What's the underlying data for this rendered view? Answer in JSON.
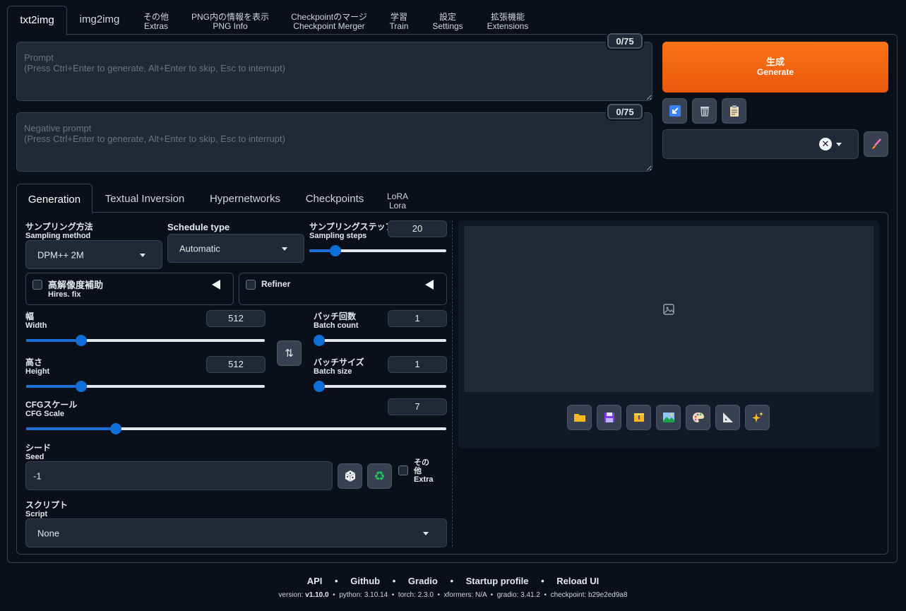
{
  "top_tabs": {
    "txt2img": "txt2img",
    "img2img": "img2img",
    "extras_jp": "その他",
    "extras_en": "Extras",
    "pnginfo_jp": "PNG内の情報を表示",
    "pnginfo_en": "PNG Info",
    "merger_jp": "Checkpointのマージ",
    "merger_en": "Checkpoint Merger",
    "train_jp": "学習",
    "train_en": "Train",
    "settings_jp": "設定",
    "settings_en": "Settings",
    "extensions_jp": "拡張機能",
    "extensions_en": "Extensions"
  },
  "prompt": {
    "placeholder": "Prompt\n(Press Ctrl+Enter to generate, Alt+Enter to skip, Esc to interrupt)",
    "counter": "0/75"
  },
  "negative_prompt": {
    "placeholder": "Negative prompt\n(Press Ctrl+Enter to generate, Alt+Enter to skip, Esc to interrupt)",
    "counter": "0/75"
  },
  "generate": {
    "jp": "生成",
    "en": "Generate"
  },
  "tool_icons": [
    "arrow-icon",
    "trash-icon",
    "clipboard-icon",
    "brush-icon",
    "close-icon"
  ],
  "sub_tabs": {
    "generation": "Generation",
    "textual_inversion": "Textual Inversion",
    "hypernetworks": "Hypernetworks",
    "checkpoints": "Checkpoints",
    "lora_jp": "LoRA",
    "lora_en": "Lora"
  },
  "sampling_method": {
    "jp": "サンプリング方法",
    "en": "Sampling method",
    "value": "DPM++ 2M"
  },
  "schedule_type": {
    "label": "Schedule type",
    "value": "Automatic"
  },
  "sampling_steps": {
    "jp": "サンプリングステップ数",
    "en": "Sampling steps",
    "value": "20",
    "fraction": 0.19
  },
  "hires": {
    "jp": "高解像度補助",
    "en": "Hires. fix"
  },
  "refiner": {
    "label": "Refiner"
  },
  "width": {
    "jp": "幅",
    "en": "Width",
    "value": "512",
    "fraction": 0.23
  },
  "height": {
    "jp": "高さ",
    "en": "Height",
    "value": "512",
    "fraction": 0.23
  },
  "batch_count": {
    "jp": "バッチ回数",
    "en": "Batch count",
    "value": "1",
    "fraction": 0.0
  },
  "batch_size": {
    "jp": "バッチサイズ",
    "en": "Batch size",
    "value": "1",
    "fraction": 0.0
  },
  "cfg_scale": {
    "jp": "CFGスケール",
    "en": "CFG Scale",
    "value": "7",
    "fraction": 0.214
  },
  "seed": {
    "jp": "シード",
    "en": "Seed",
    "value": "-1"
  },
  "extra": {
    "jp1": "その",
    "jp2": "他",
    "en": "Extra"
  },
  "script": {
    "jp": "スクリプト",
    "en": "Script",
    "value": "None"
  },
  "gallery_icons": [
    "folder-icon",
    "save-icon",
    "zip-icon",
    "image-icon",
    "palette-icon",
    "ruler-icon",
    "sparkle-icon"
  ],
  "footer": {
    "api": "API",
    "github": "Github",
    "gradio": "Gradio",
    "startup": "Startup profile",
    "reload": "Reload UI",
    "sep": "•",
    "version_label": "version:",
    "version": "v1.10.0",
    "python_label": "python:",
    "python": "3.10.14",
    "torch_label": "torch:",
    "torch": "2.3.0",
    "xformers_label": "xformers:",
    "xformers": "N/A",
    "gradio_label": "gradio:",
    "gradio_v": "3.41.2",
    "checkpoint_label": "checkpoint:",
    "checkpoint": "b29e2ed9a8"
  },
  "colors": {
    "accent": "#f97316",
    "slider": "#0f6fd8",
    "bg": "#0b0f19",
    "panel": "#1f2937"
  }
}
